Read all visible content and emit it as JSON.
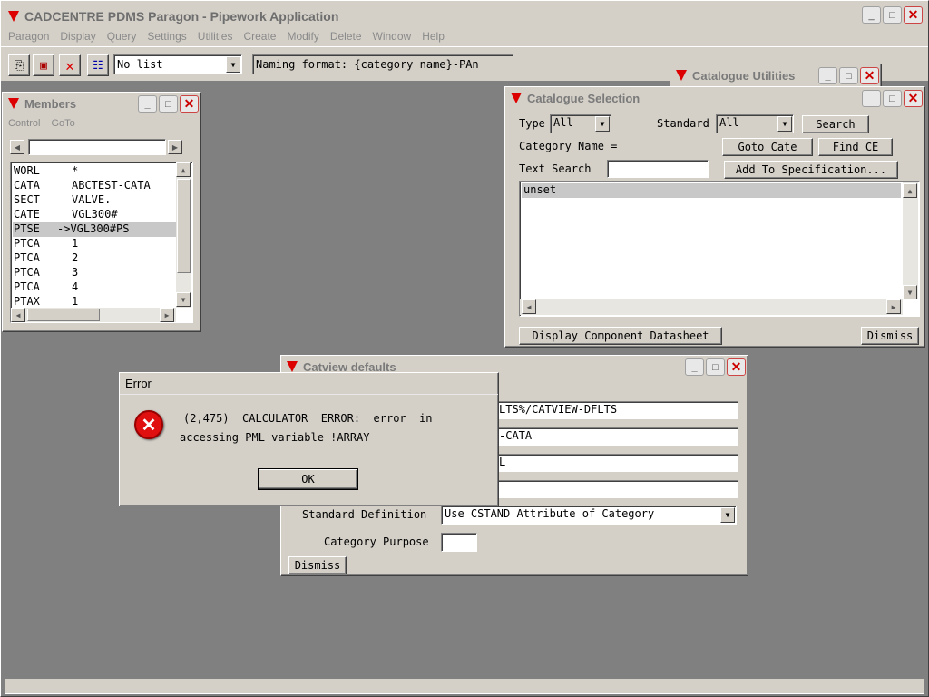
{
  "app": {
    "title": "CADCENTRE PDMS Paragon - Pipework Application",
    "menu": [
      "Paragon",
      "Display",
      "Query",
      "Settings",
      "Utilities",
      "Create",
      "Modify",
      "Delete",
      "Window",
      "Help"
    ],
    "list_select": "No list",
    "naming_format": "Naming format: {category name}-PAn"
  },
  "members": {
    "title": "Members",
    "menu": [
      "Control",
      "GoTo"
    ],
    "rows": [
      {
        "a": "WORL",
        "b": "*"
      },
      {
        "a": "CATA",
        "b": "ABCTEST-CATA"
      },
      {
        "a": "SECT",
        "b": "VALVE."
      },
      {
        "a": "CATE",
        "b": "VGL300#"
      },
      {
        "a": "PTSE",
        "b": "->VGL300#PS"
      },
      {
        "a": "PTCA",
        "b": "1"
      },
      {
        "a": "PTCA",
        "b": "2"
      },
      {
        "a": "PTCA",
        "b": "3"
      },
      {
        "a": "PTCA",
        "b": "4"
      },
      {
        "a": "PTAX",
        "b": "1"
      }
    ]
  },
  "catutil": {
    "title": "Catalogue Utilities"
  },
  "catsel": {
    "title": "Catalogue Selection",
    "type_label": "Type",
    "type_value": "All",
    "standard_label": "Standard",
    "standard_value": "All",
    "search": "Search",
    "category_name": "Category Name =",
    "goto_cate": "Goto Cate",
    "find_ce": "Find CE",
    "text_search": "Text Search",
    "add_to_spec": "Add To Specification...",
    "list_item": "unset",
    "display_datasheet": "Display Component Datasheet",
    "dismiss": "Dismiss"
  },
  "catview": {
    "title": "Catview defaults",
    "f1": "LTS%/CATVIEW-DFLTS",
    "f2": "-CATA",
    "f3": "L",
    "f4": "",
    "std_def_label": "Standard Definition",
    "std_def_value": "Use CSTAND Attribute of Category",
    "purpose_label": "Category Purpose",
    "purpose_value": "",
    "dismiss": "Dismiss"
  },
  "error": {
    "title": "Error",
    "line1": "(2,475)  CALCULATOR  ERROR:  error  in",
    "line2": "accessing PML variable !ARRAY",
    "ok": "OK"
  }
}
